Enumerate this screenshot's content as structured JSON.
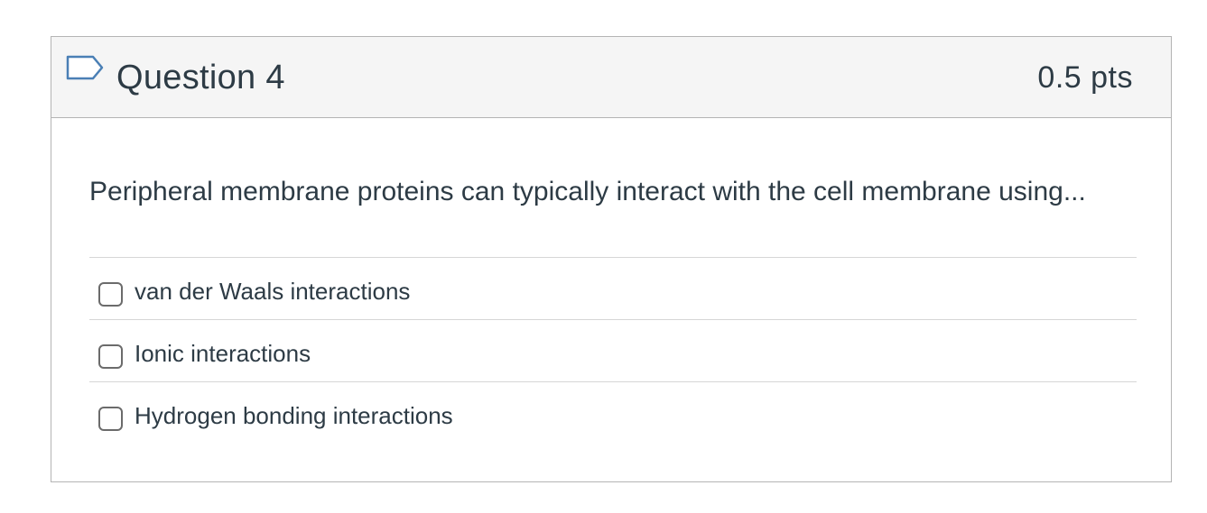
{
  "question": {
    "title": "Question 4",
    "points": "0.5 pts",
    "flag_icon": "flag-outline-icon",
    "text": "Peripheral membrane proteins can typically interact with the cell membrane using...",
    "answers": [
      {
        "label": "van der Waals interactions",
        "checked": false
      },
      {
        "label": "Ionic interactions",
        "checked": false
      },
      {
        "label": "Hydrogen bonding interactions",
        "checked": false
      }
    ]
  },
  "colors": {
    "header_bg": "#f5f5f5",
    "border": "#b4b4b4",
    "text": "#2d3b45",
    "flag": "#4a7fb5"
  }
}
